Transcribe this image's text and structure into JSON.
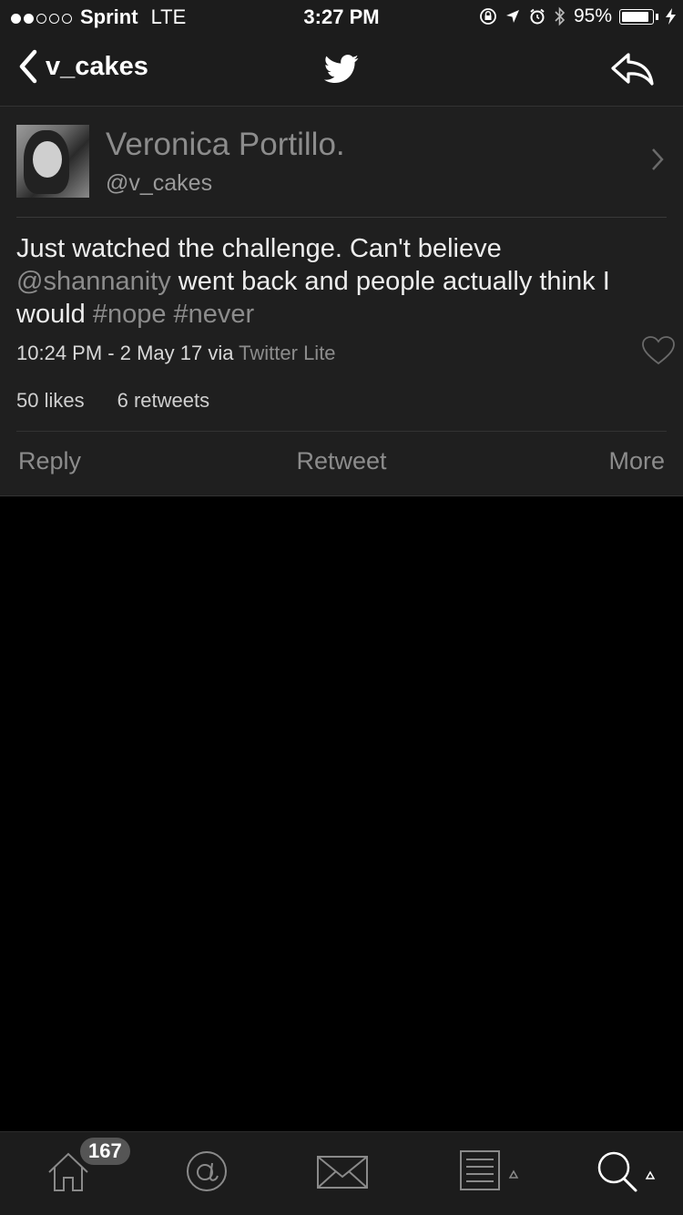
{
  "status_bar": {
    "carrier": "Sprint",
    "network": "LTE",
    "time": "3:27 PM",
    "battery_percent": "95%",
    "battery_level": 0.95,
    "signal_bars_filled": 2,
    "signal_bars_total": 5
  },
  "nav": {
    "back_label": "v_cakes"
  },
  "profile": {
    "name": "Veronica Portillo.",
    "handle": "@v_cakes"
  },
  "tweet": {
    "text_part1": "Just watched the challenge.  Can't believe ",
    "mention": "@shannanity",
    "text_part2": " went back and people actually think I would ",
    "hashtag1": "#nope",
    "hashtag2": "#never",
    "meta_prefix": "10:24 PM - 2 May 17 via ",
    "via_app": "Twitter Lite",
    "likes": "50 likes",
    "retweets": "6 retweets"
  },
  "actions": {
    "reply": "Reply",
    "retweet": "Retweet",
    "more": "More"
  },
  "tab_bar": {
    "home_badge": "167",
    "icons": [
      "home-icon",
      "mentions-icon",
      "messages-icon",
      "lists-icon",
      "search-icon"
    ]
  },
  "colors": {
    "background": "#000000",
    "bar": "#1c1c1c",
    "panel": "#1f1f1f",
    "muted": "#8c8c8c"
  }
}
